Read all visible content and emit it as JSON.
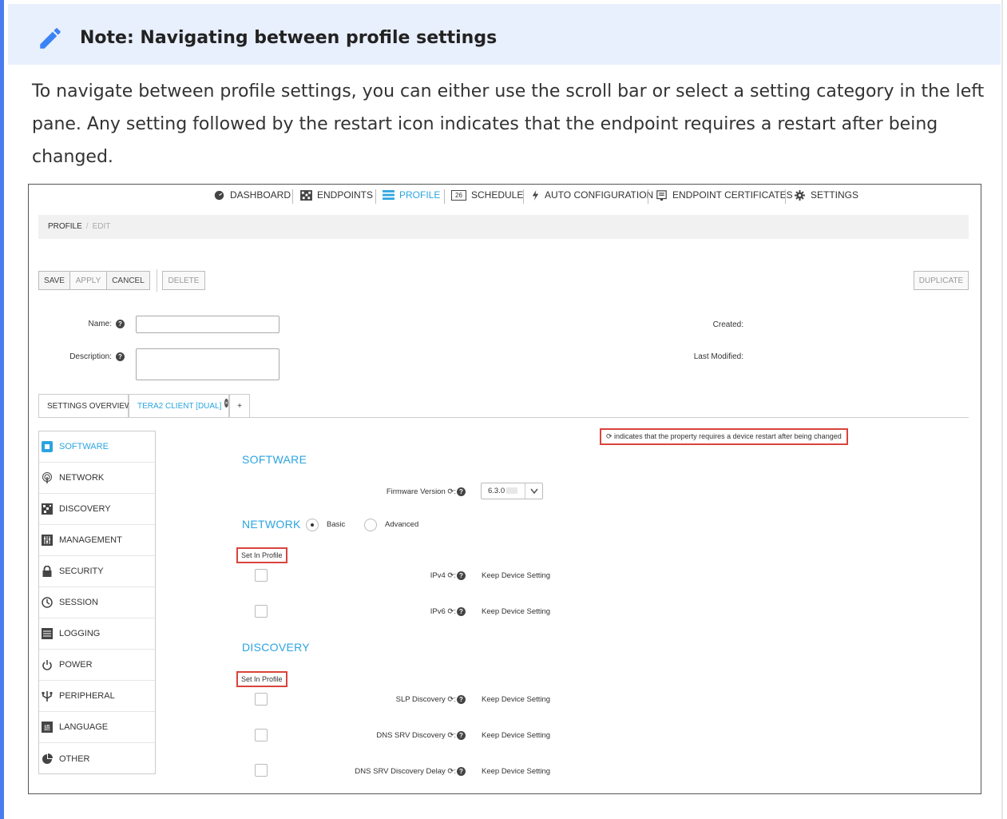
{
  "note": {
    "title": "Note: Navigating between profile settings",
    "body": "To navigate between profile settings, you can either use the scroll bar or select a setting category in the left pane. Any setting followed by the restart icon indicates that the endpoint requires a restart after being changed."
  },
  "nav": {
    "dashboard": "DASHBOARD",
    "endpoints": "ENDPOINTS",
    "profile": "PROFILE",
    "schedule_day": "26",
    "schedule": "SCHEDULE",
    "auto_config": "AUTO CONFIGURATION",
    "certificates": "ENDPOINT CERTIFICATES",
    "settings": "SETTINGS"
  },
  "breadcrumb": {
    "first": "PROFILE",
    "second": "EDIT"
  },
  "toolbar": {
    "save": "SAVE",
    "apply": "APPLY",
    "cancel": "CANCEL",
    "delete": "DELETE",
    "duplicate": "DUPLICATE"
  },
  "form": {
    "name_label": "Name:",
    "description_label": "Description:",
    "created_label": "Created:",
    "modified_label": "Last Modified:"
  },
  "tabs": {
    "overview": "SETTINGS OVERVIEW",
    "client": "TERA2 CLIENT [DUAL]",
    "add": "+"
  },
  "sidebar": {
    "items": [
      {
        "label": "SOFTWARE",
        "icon": "software-icon"
      },
      {
        "label": "NETWORK",
        "icon": "network-icon"
      },
      {
        "label": "DISCOVERY",
        "icon": "discovery-icon"
      },
      {
        "label": "MANAGEMENT",
        "icon": "management-icon"
      },
      {
        "label": "SECURITY",
        "icon": "lock-icon"
      },
      {
        "label": "SESSION",
        "icon": "clock-icon"
      },
      {
        "label": "LOGGING",
        "icon": "log-icon"
      },
      {
        "label": "POWER",
        "icon": "power-icon"
      },
      {
        "label": "PERIPHERAL",
        "icon": "usb-icon"
      },
      {
        "label": "LANGUAGE",
        "icon": "language-icon"
      },
      {
        "label": "OTHER",
        "icon": "pie-icon"
      }
    ]
  },
  "restart_note": "⟳ indicates that the property requires a device restart after being changed",
  "software": {
    "title": "SOFTWARE",
    "firmware_label": "Firmware Version ⟳:",
    "firmware_value": "6.3.0"
  },
  "network": {
    "title": "NETWORK",
    "basic": "Basic",
    "advanced": "Advanced",
    "set_in_profile": "Set In Profile",
    "ipv4_label": "IPv4 ⟳:",
    "ipv6_label": "IPv6 ⟳:",
    "keep": "Keep Device Setting"
  },
  "discovery": {
    "title": "DISCOVERY",
    "set_in_profile": "Set In Profile",
    "slp_label": "SLP Discovery ⟳:",
    "dns_label": "DNS SRV Discovery ⟳:",
    "dns_delay_label": "DNS SRV Discovery Delay ⟳:",
    "keep": "Keep Device Setting"
  },
  "colors": {
    "accent": "#2ba4e0",
    "note_border": "#4a7cf0",
    "note_header": "#e8effd",
    "highlight": "#d9443c"
  }
}
